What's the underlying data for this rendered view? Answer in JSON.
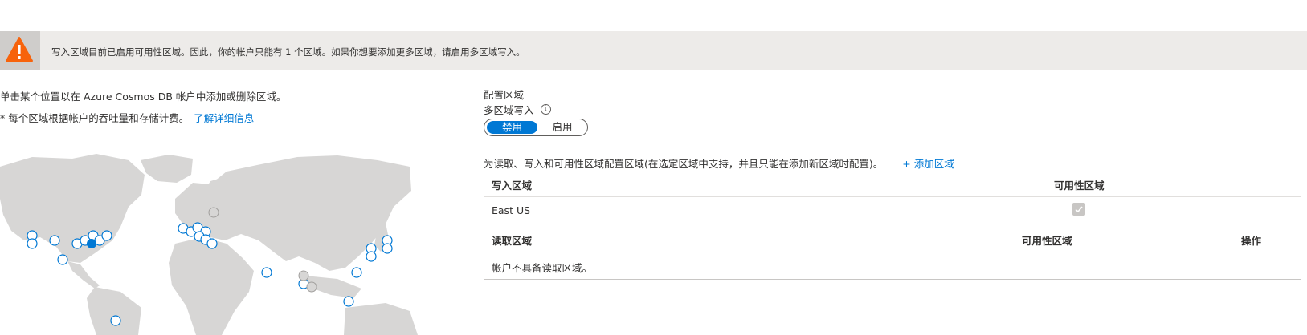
{
  "banner": {
    "message": "写入区域目前已启用可用性区域。因此，你的帐户只能有 1 个区域。如果你想要添加更多区域，请启用多区域写入。",
    "icon": "warning-icon",
    "accent": "#f7630c"
  },
  "left": {
    "intro": "单击某个位置以在 Azure Cosmos DB 帐户中添加或删除区域。",
    "note": "* 每个区域根据帐户的吞吐量和存储计费。",
    "learn_more": "了解详细信息"
  },
  "config": {
    "title": "配置区域",
    "multi_write_label": "多区域写入",
    "toggle": {
      "disabled": "禁用",
      "enabled": "启用",
      "selected": "禁用"
    },
    "description": "为读取、写入和可用性区域配置区域(在选定区域中支持，并且只能在添加新区域时配置)。",
    "add_region": "+ 添加区域"
  },
  "write_table": {
    "headers": [
      "写入区域",
      "可用性区域"
    ],
    "rows": [
      {
        "region": "East US",
        "az_checked": true
      }
    ]
  },
  "read_table": {
    "headers": [
      "读取区域",
      "可用性区域",
      "操作"
    ],
    "empty": "帐户不具备读取区域。"
  },
  "colors": {
    "accent": "#0078d4",
    "map_land": "#d2d0ce",
    "hex": "#0078d4"
  }
}
